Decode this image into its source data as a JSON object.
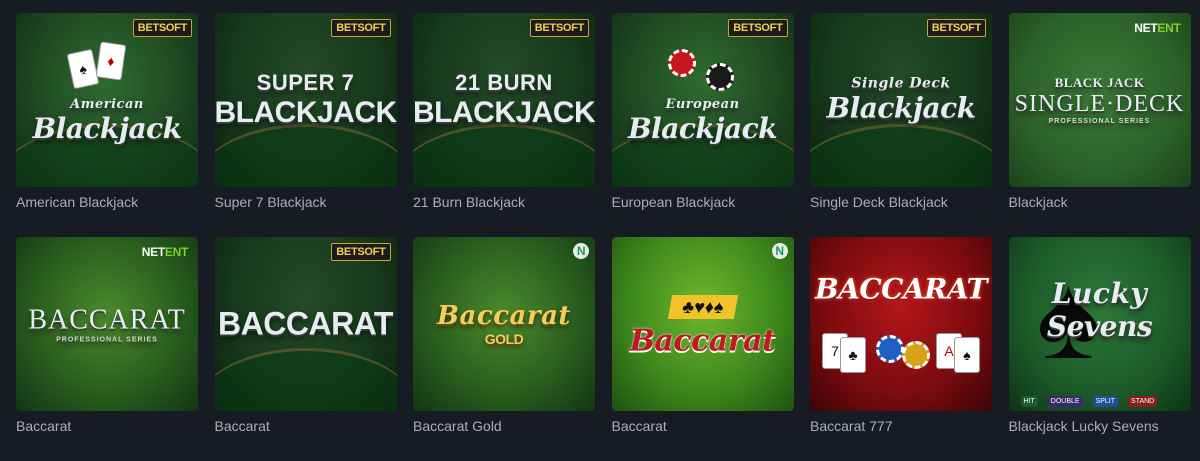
{
  "games": [
    {
      "title": "American Blackjack",
      "provider": "BETSOFT",
      "logo": [
        "American",
        "Blackjack"
      ]
    },
    {
      "title": "Super 7 Blackjack",
      "provider": "BETSOFT",
      "logo": [
        "SUPER 7",
        "BLACKJACK"
      ]
    },
    {
      "title": "21 Burn Blackjack",
      "provider": "BETSOFT",
      "logo": [
        "21 BURN",
        "BLACKJACK"
      ]
    },
    {
      "title": "European Blackjack",
      "provider": "BETSOFT",
      "logo": [
        "European",
        "Blackjack"
      ]
    },
    {
      "title": "Single Deck Blackjack",
      "provider": "BETSOFT",
      "logo": [
        "Single Deck",
        "Blackjack"
      ]
    },
    {
      "title": "Blackjack",
      "provider_a": "NET",
      "provider_b": "ENT",
      "logo": [
        "BLACK JACK",
        "SINGLE·DECK",
        "PROFESSIONAL SERIES"
      ]
    },
    {
      "title": "Baccarat",
      "provider_a": "NET",
      "provider_b": "ENT",
      "logo": [
        "",
        "BACCARAT",
        "PROFESSIONAL SERIES"
      ]
    },
    {
      "title": "Baccarat",
      "provider": "BETSOFT",
      "logo": [
        "",
        "BACCARAT"
      ]
    },
    {
      "title": "Baccarat Gold",
      "provider": "N",
      "logo": [
        "Baccarat",
        "GOLD"
      ]
    },
    {
      "title": "Baccarat",
      "provider": "N",
      "logo": [
        "",
        "Baccarat"
      ]
    },
    {
      "title": "Baccarat 777",
      "logo": [
        "",
        "BACCARAT"
      ]
    },
    {
      "title": "Blackjack Lucky Sevens",
      "logo": [
        "Lucky",
        "Sevens"
      ],
      "buttons": [
        "HIT",
        "DOUBLE",
        "SPLIT",
        "STAND"
      ]
    }
  ],
  "colors": {
    "background": "#171b24",
    "label": "#a7afbd",
    "betsoft_gold": "#f0d050",
    "netent_green": "#7cd12a"
  }
}
